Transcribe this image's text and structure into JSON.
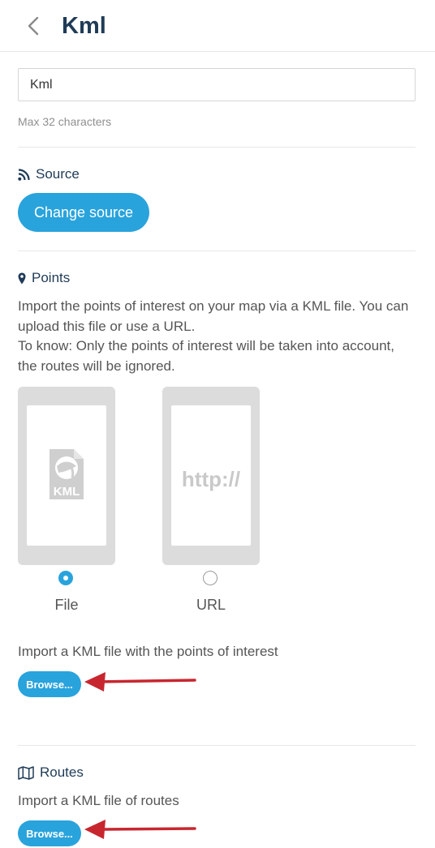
{
  "header": {
    "title": "Kml",
    "back_icon": "chevron-left-icon"
  },
  "name_field": {
    "value": "Kml",
    "hint": "Max 32 characters"
  },
  "source": {
    "title": "Source",
    "icon": "rss-icon",
    "button_label": "Change source"
  },
  "points": {
    "title": "Points",
    "icon": "map-marker-icon",
    "description_1": "Import the points of interest on your map via a KML file. You can upload this file or use a URL.",
    "description_2": "To know: Only the points of interest will be taken into account, the routes will be ignored.",
    "options": [
      {
        "label": "File",
        "selected": true,
        "preview_text": "KML"
      },
      {
        "label": "URL",
        "selected": false,
        "preview_text": "http://"
      }
    ],
    "import_text": "Import a KML file with the points of interest",
    "browse_label": "Browse..."
  },
  "routes": {
    "title": "Routes",
    "icon": "map-icon",
    "import_text": "Import a KML file of routes",
    "browse_label": "Browse..."
  },
  "colors": {
    "accent": "#29a3dc",
    "title": "#1f3b57",
    "arrow": "#c8262f"
  }
}
